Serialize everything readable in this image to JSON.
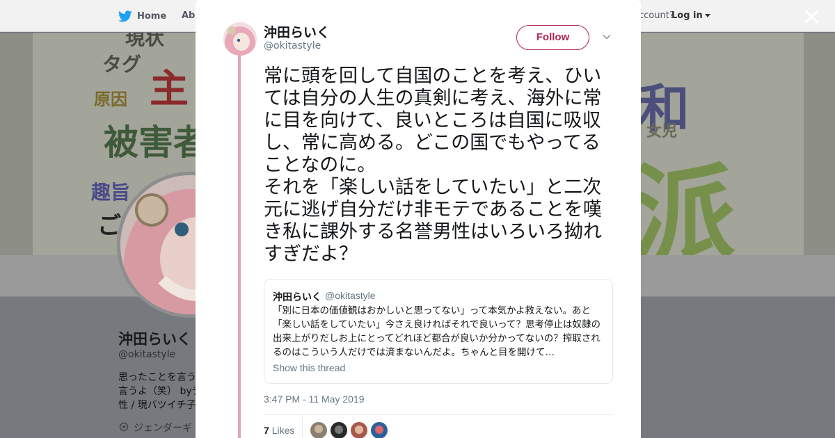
{
  "topbar": {
    "home_label": "Home",
    "about_label": "Abo",
    "account_prompt": "ccount?",
    "login_label": "Log in"
  },
  "banner": {
    "words": [
      "現状",
      "タグ",
      "原因",
      "主",
      "被害者",
      "趣旨",
      "ご",
      "和",
      "女児",
      "派"
    ]
  },
  "background_profile": {
    "name": "沖田らいく",
    "handle": "@okitastyle",
    "bio_line1": "思ったことを言う",
    "bio_line2": "言うよ（笑） byデ",
    "bio_line3": "性 / 現バツイチ子",
    "location": "ジェンダーギ"
  },
  "tweet": {
    "author_name": "沖田らいく",
    "author_handle": "@okitastyle",
    "follow_label": "Follow",
    "text_p1": "常に頭を回して自国のことを考え、ひいては自分の人生の真剣に考え、海外に常に目を向けて、良いところは自国に吸収し、常に高める。どこの国でもやってることなのに。",
    "text_p2": "それを「楽しい話をしていたい」と二次元に逃げ自分だけ非モテであることを嘆き私に課外する名誉男性はいろいろ拗れすぎだよ？",
    "timestamp": "3:47 PM - 11 May 2019",
    "likes_count": "7",
    "likes_label": "Likes"
  },
  "quote": {
    "author_name": "沖田らいく",
    "author_handle": "@okitastyle",
    "text": "「別に日本の価値観はおかしいと思ってない」って本気かよ救えない。あと「楽しい話をしていたい」今さえ良ければそれで良いって？思考停止は奴隷の出来上がりだしお上にとってどれほど都合が良いか分かってないの？搾取されるのはこういう人だけでは済まないんだよ。ちゃんと目を開けて…",
    "show_thread": "Show this thread"
  },
  "colors": {
    "accent": "#b0264f",
    "thread_line": "#e0a9b6",
    "muted_text": "#657786",
    "twitter_blue": "#1da1f2"
  },
  "icons": [
    "twitter-bird-icon",
    "close-icon",
    "chevron-down-icon",
    "location-pin-icon"
  ]
}
